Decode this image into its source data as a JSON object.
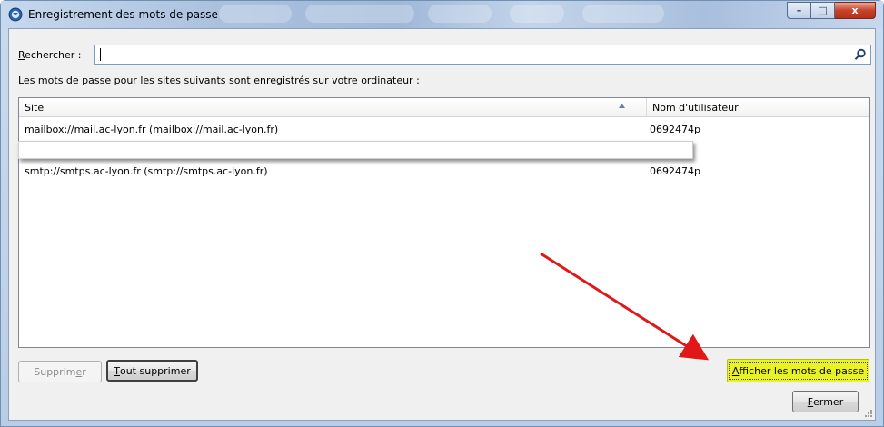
{
  "window": {
    "title": "Enregistrement des mots de passe",
    "buttons": {
      "minimize": "–",
      "maximize": "□",
      "close": "x"
    }
  },
  "search": {
    "label_accel": "R",
    "label_rest": "echercher :",
    "value": "",
    "placeholder": ""
  },
  "info_text": "Les mots de passe pour les sites suivants sont enregistrés sur votre ordinateur :",
  "list": {
    "columns": {
      "site": "Site",
      "username": "Nom d'utilisateur"
    },
    "rows": [
      {
        "site": "mailbox://mail.ac-lyon.fr (mailbox://mail.ac-lyon.fr)",
        "username": "0692474p"
      },
      {
        "site": "",
        "username": ""
      },
      {
        "site": "smtp://smtps.ac-lyon.fr (smtp://smtps.ac-lyon.fr)",
        "username": "0692474p"
      }
    ]
  },
  "buttons": {
    "delete_pre": "Supprim",
    "delete_accel": "e",
    "delete_post": "r",
    "delete_all_accel": "T",
    "delete_all_rest": "out supprimer",
    "show_accel": "A",
    "show_rest": "fficher les mots de passe",
    "close_accel": "F",
    "close_rest": "ermer"
  },
  "colors": {
    "highlight": "#e9f227",
    "annotation_arrow": "#e01818"
  },
  "icons": {
    "app": "thunderbird-icon",
    "search": "search-icon",
    "sort": "sort-ascending-icon"
  }
}
